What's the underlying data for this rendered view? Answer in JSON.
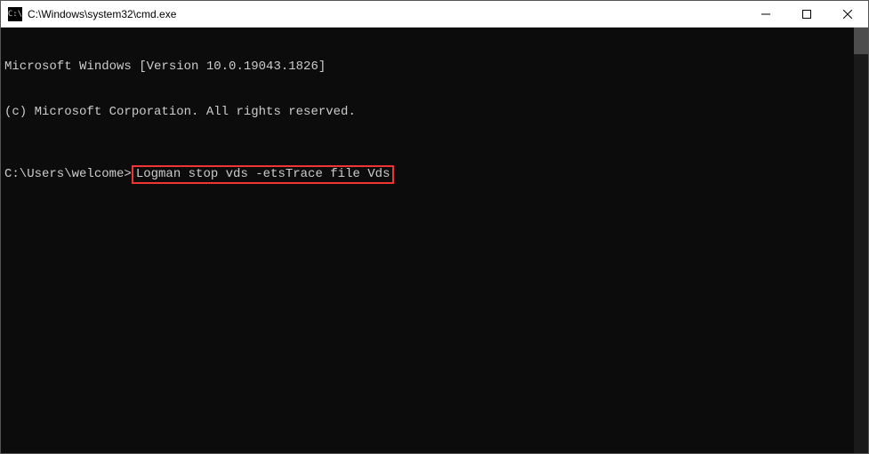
{
  "window": {
    "icon_label": "C:\\",
    "title": "C:\\Windows\\system32\\cmd.exe"
  },
  "terminal": {
    "line1": "Microsoft Windows [Version 10.0.19043.1826]",
    "line2": "(c) Microsoft Corporation. All rights reserved.",
    "prompt": "C:\\Users\\welcome>",
    "command": "Logman stop vds -etsTrace file Vds"
  }
}
